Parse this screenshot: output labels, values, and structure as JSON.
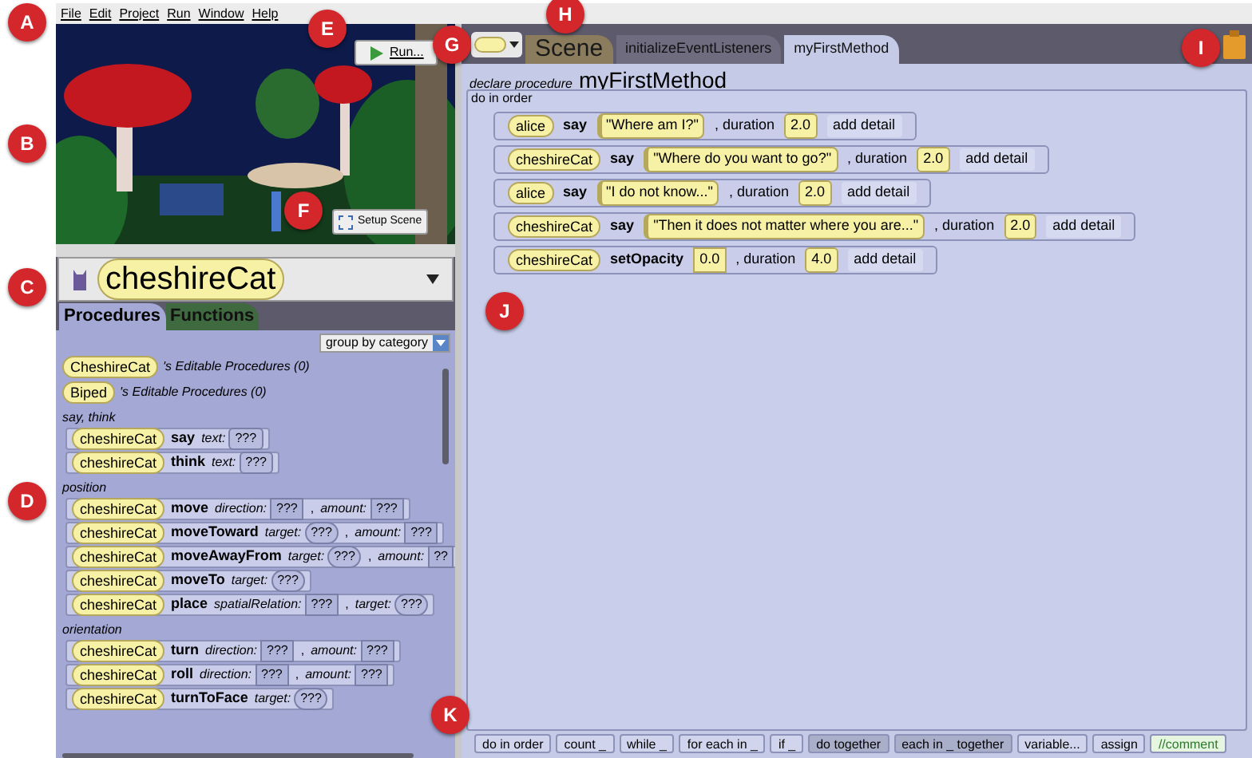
{
  "callouts": [
    "A",
    "B",
    "C",
    "D",
    "E",
    "F",
    "G",
    "H",
    "I",
    "J",
    "K"
  ],
  "menu": [
    "File",
    "Edit",
    "Project",
    "Run",
    "Window",
    "Help"
  ],
  "run_button": {
    "label": "Run..."
  },
  "setup_button": {
    "label": "Setup Scene"
  },
  "object_selector": {
    "value": "cheshireCat"
  },
  "palette_tabs": [
    {
      "label": "Procedures",
      "selected": true
    },
    {
      "label": "Functions",
      "selected": false
    }
  ],
  "group_dropdown": {
    "value": "group by category"
  },
  "editable": [
    {
      "type": "CheshireCat",
      "text": "'s Editable Procedures (0)"
    },
    {
      "type": "Biped",
      "text": "'s Editable Procedures (0)"
    }
  ],
  "categories": [
    {
      "title": "say, think",
      "procedures": [
        {
          "subject": "cheshireCat",
          "method": "say",
          "params": [
            {
              "label": "text:",
              "value": "???",
              "kind": "text"
            }
          ]
        },
        {
          "subject": "cheshireCat",
          "method": "think",
          "params": [
            {
              "label": "text:",
              "value": "???",
              "kind": "text"
            }
          ]
        }
      ]
    },
    {
      "title": "position",
      "procedures": [
        {
          "subject": "cheshireCat",
          "method": "move",
          "params": [
            {
              "label": "direction:",
              "value": "???",
              "kind": "number"
            },
            {
              "prefix": ",",
              "label": "amount:",
              "value": "???",
              "kind": "number"
            }
          ]
        },
        {
          "subject": "cheshireCat",
          "method": "moveToward",
          "params": [
            {
              "label": "target:",
              "value": "???",
              "kind": "object"
            },
            {
              "prefix": ",",
              "label": "amount:",
              "value": "???",
              "kind": "number"
            }
          ]
        },
        {
          "subject": "cheshireCat",
          "method": "moveAwayFrom",
          "params": [
            {
              "label": "target:",
              "value": "???",
              "kind": "object"
            },
            {
              "prefix": ",",
              "label": "amount:",
              "value": "??",
              "kind": "number"
            }
          ]
        },
        {
          "subject": "cheshireCat",
          "method": "moveTo",
          "params": [
            {
              "label": "target:",
              "value": "???",
              "kind": "object"
            }
          ]
        },
        {
          "subject": "cheshireCat",
          "method": "place",
          "params": [
            {
              "label": "spatialRelation:",
              "value": "???",
              "kind": "number"
            },
            {
              "prefix": ",",
              "label": "target:",
              "value": "???",
              "kind": "object"
            }
          ]
        }
      ]
    },
    {
      "title": "orientation",
      "procedures": [
        {
          "subject": "cheshireCat",
          "method": "turn",
          "params": [
            {
              "label": "direction:",
              "value": "???",
              "kind": "number"
            },
            {
              "prefix": ",",
              "label": "amount:",
              "value": "???",
              "kind": "number"
            }
          ]
        },
        {
          "subject": "cheshireCat",
          "method": "roll",
          "params": [
            {
              "label": "direction:",
              "value": "???",
              "kind": "number"
            },
            {
              "prefix": ",",
              "label": "amount:",
              "value": "???",
              "kind": "number"
            }
          ]
        },
        {
          "subject": "cheshireCat",
          "method": "turnToFace",
          "params": [
            {
              "label": "target:",
              "value": "???",
              "kind": "object"
            }
          ]
        }
      ]
    }
  ],
  "editor_tabs": [
    {
      "label": "Scene",
      "kind": "scene",
      "selected": false
    },
    {
      "label": "initializeEventListeners",
      "kind": "method",
      "selected": false
    },
    {
      "label": "myFirstMethod",
      "kind": "method",
      "selected": true
    }
  ],
  "declaration": {
    "prefix": "declare procedure",
    "name": "myFirstMethod"
  },
  "block": {
    "label": "do in order"
  },
  "statements": [
    {
      "subject": "alice",
      "method": "say",
      "first": {
        "value": "\"Where am I?\"",
        "kind": "text"
      },
      "duration_label": ", duration",
      "duration": "2.0",
      "detail": "add detail"
    },
    {
      "subject": "cheshireCat",
      "method": "say",
      "first": {
        "value": "\"Where do you want to go?\"",
        "kind": "text"
      },
      "duration_label": ", duration",
      "duration": "2.0",
      "detail": "add detail"
    },
    {
      "subject": "alice",
      "method": "say",
      "first": {
        "value": "\"I do not know...\"",
        "kind": "text"
      },
      "duration_label": ", duration",
      "duration": "2.0",
      "detail": "add detail"
    },
    {
      "subject": "cheshireCat",
      "method": "say",
      "first": {
        "value": "\"Then it does not matter where you are...\"",
        "kind": "text"
      },
      "duration_label": ", duration",
      "duration": "2.0",
      "detail": "add detail"
    },
    {
      "subject": "cheshireCat",
      "method": "setOpacity",
      "first": {
        "value": "0.0",
        "kind": "number"
      },
      "duration_label": ", duration",
      "duration": "4.0",
      "detail": "add detail"
    }
  ],
  "control_palette": [
    {
      "label": "do in order",
      "kind": "plain"
    },
    {
      "label": "count _",
      "kind": "plain"
    },
    {
      "label": "while _",
      "kind": "plain"
    },
    {
      "label": "for each in _",
      "kind": "plain"
    },
    {
      "label": "if _",
      "kind": "plain"
    },
    {
      "label": "do together",
      "kind": "parallel"
    },
    {
      "label": "each in _ together",
      "kind": "parallel"
    },
    {
      "label": "variable...",
      "kind": "plain"
    },
    {
      "label": "assign",
      "kind": "plain"
    },
    {
      "label": "//comment",
      "kind": "comment"
    }
  ]
}
